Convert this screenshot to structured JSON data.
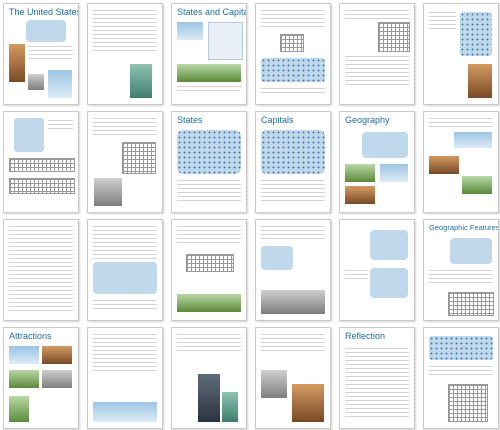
{
  "document": {
    "pages": [
      {
        "title": "The United States"
      },
      {
        "title": ""
      },
      {
        "title": "States and Capitals"
      },
      {
        "title": ""
      },
      {
        "title": ""
      },
      {
        "title": ""
      },
      {
        "title": ""
      },
      {
        "title": ""
      },
      {
        "title": "States"
      },
      {
        "title": "Capitals"
      },
      {
        "title": "Geography"
      },
      {
        "title": ""
      },
      {
        "title": ""
      },
      {
        "title": ""
      },
      {
        "title": ""
      },
      {
        "title": ""
      },
      {
        "title": ""
      },
      {
        "title": ""
      },
      {
        "title": "Geographic Features"
      },
      {
        "title": "Attractions"
      },
      {
        "title": ""
      },
      {
        "title": ""
      },
      {
        "title": "Reflection"
      },
      {
        "title": ""
      }
    ],
    "colors": {
      "title": "#1d6fa6",
      "page_border": "#c9c9c9",
      "map": "#bfd8ec"
    }
  }
}
